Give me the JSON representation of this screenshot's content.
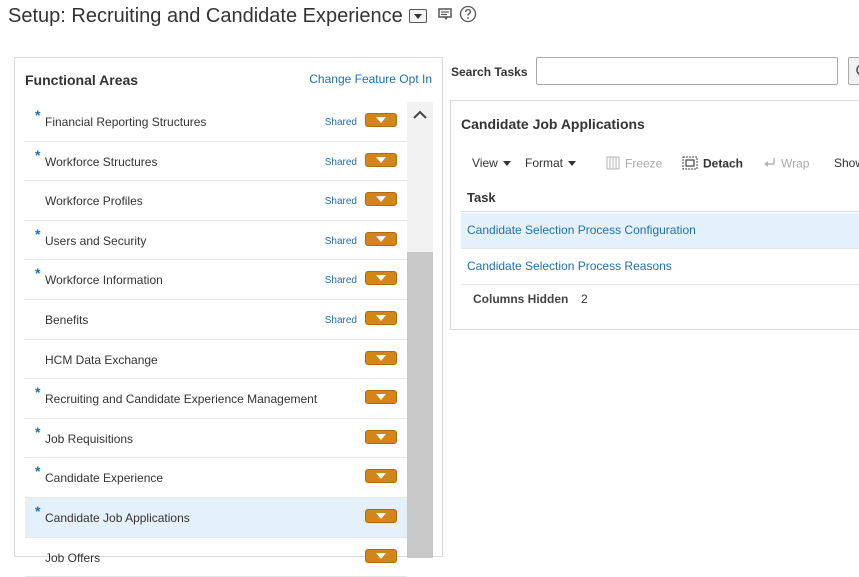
{
  "header": {
    "title": "Setup: Recruiting and Candidate Experience",
    "title_menu_icon": "chevron-down-icon",
    "icons": [
      "navigator-icon",
      "help-icon"
    ]
  },
  "functional_areas": {
    "heading": "Functional Areas",
    "opt_in_link": "Change Feature Opt In",
    "items": [
      {
        "label": "Financial Reporting Structures",
        "required": "*",
        "shared": "Shared"
      },
      {
        "label": "Workforce Structures",
        "required": "*",
        "shared": "Shared"
      },
      {
        "label": "Workforce Profiles",
        "required": "",
        "shared": "Shared"
      },
      {
        "label": "Users and Security",
        "required": "*",
        "shared": "Shared"
      },
      {
        "label": "Workforce Information",
        "required": "*",
        "shared": "Shared"
      },
      {
        "label": "Benefits",
        "required": "",
        "shared": "Shared"
      },
      {
        "label": "HCM Data Exchange",
        "required": "",
        "shared": ""
      },
      {
        "label": "Recruiting and Candidate Experience Management",
        "required": "*",
        "shared": ""
      },
      {
        "label": "Job Requisitions",
        "required": "*",
        "shared": ""
      },
      {
        "label": "Candidate Experience",
        "required": "*",
        "shared": ""
      },
      {
        "label": "Candidate Job Applications",
        "required": "*",
        "shared": "",
        "selected": true
      },
      {
        "label": "Job Offers",
        "required": "",
        "shared": ""
      }
    ]
  },
  "search": {
    "label": "Search Tasks",
    "value": "",
    "placeholder": ""
  },
  "task_panel": {
    "title": "Candidate Job Applications",
    "toolbar": {
      "view": "View",
      "format": "Format",
      "freeze": "Freeze",
      "detach": "Detach",
      "wrap": "Wrap",
      "show": "Show"
    },
    "column_header": "Task",
    "rows": [
      {
        "label": "Candidate Selection Process Configuration",
        "selected": true
      },
      {
        "label": "Candidate Selection Process Reasons",
        "selected": false
      }
    ],
    "columns_hidden_label": "Columns Hidden",
    "columns_hidden_count": "2"
  },
  "colors": {
    "link": "#1f6fb3",
    "menu_button": "#d3841b",
    "selected_row": "#e4f1fb"
  }
}
